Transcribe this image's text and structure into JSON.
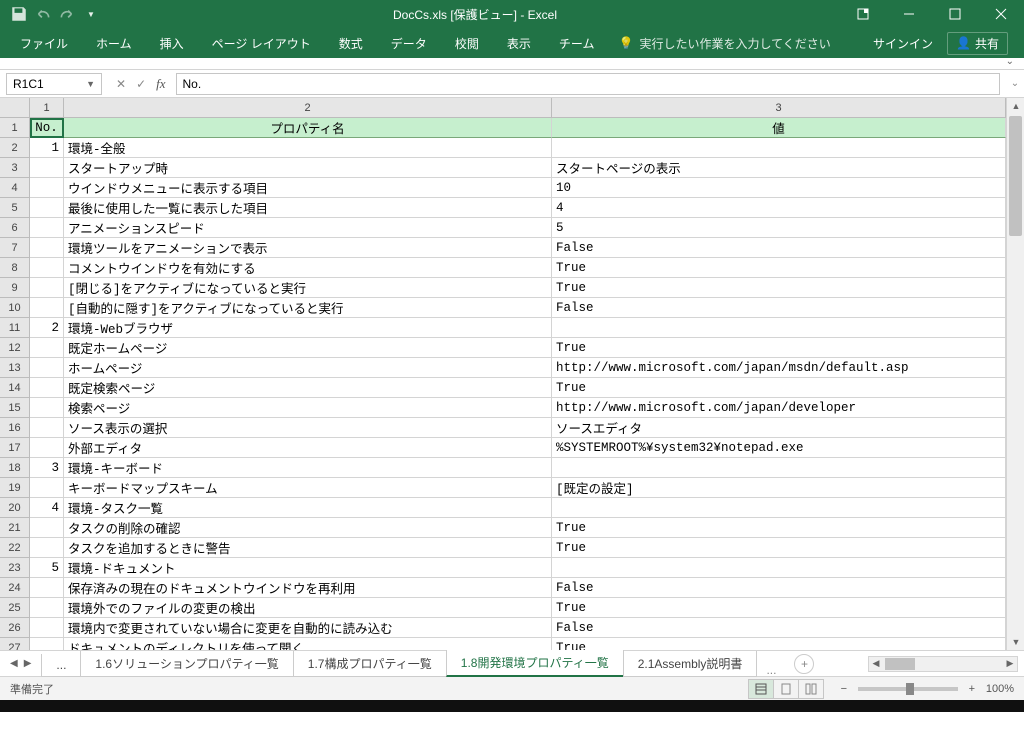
{
  "title": "DocCs.xls [保護ビュー] - Excel",
  "ribbon": {
    "file": "ファイル",
    "home": "ホーム",
    "insert": "挿入",
    "pageLayout": "ページ レイアウト",
    "formulas": "数式",
    "data": "データ",
    "review": "校閲",
    "view": "表示",
    "team": "チーム",
    "tellme": "実行したい作業を入力してください",
    "signin": "サインイン",
    "share": "共有"
  },
  "namebox": "R1C1",
  "formula": "No.",
  "columns": {
    "c1": "1",
    "c2": "2",
    "c3": "3"
  },
  "headers": {
    "no": "No.",
    "prop": "プロパティ名",
    "val": "値"
  },
  "rows": [
    {
      "n": "1",
      "no": "1",
      "prop": "環境-全般",
      "val": ""
    },
    {
      "n": "2",
      "no": "",
      "prop": "スタートアップ時",
      "val": "スタートページの表示"
    },
    {
      "n": "3",
      "no": "",
      "prop": "ウインドウメニューに表示する項目",
      "val": "10"
    },
    {
      "n": "4",
      "no": "",
      "prop": "最後に使用した一覧に表示した項目",
      "val": "4"
    },
    {
      "n": "5",
      "no": "",
      "prop": "アニメーションスピード",
      "val": "5"
    },
    {
      "n": "6",
      "no": "",
      "prop": "環境ツールをアニメーションで表示",
      "val": "False"
    },
    {
      "n": "7",
      "no": "",
      "prop": "コメントウインドウを有効にする",
      "val": "True"
    },
    {
      "n": "8",
      "no": "",
      "prop": "[閉じる]をアクティブになっていると実行",
      "val": "True"
    },
    {
      "n": "9",
      "no": "",
      "prop": "[自動的に隠す]をアクティブになっていると実行",
      "val": "False"
    },
    {
      "n": "10",
      "no": "2",
      "prop": "環境-Webブラウザ",
      "val": ""
    },
    {
      "n": "11",
      "no": "",
      "prop": "既定ホームページ",
      "val": "True"
    },
    {
      "n": "12",
      "no": "",
      "prop": "ホームページ",
      "val": "http://www.microsoft.com/japan/msdn/default.asp"
    },
    {
      "n": "13",
      "no": "",
      "prop": "既定検索ページ",
      "val": "True"
    },
    {
      "n": "14",
      "no": "",
      "prop": "検索ページ",
      "val": "http://www.microsoft.com/japan/developer"
    },
    {
      "n": "15",
      "no": "",
      "prop": "ソース表示の選択",
      "val": "ソースエディタ"
    },
    {
      "n": "16",
      "no": "",
      "prop": "外部エディタ",
      "val": "%SYSTEMROOT%¥system32¥notepad.exe"
    },
    {
      "n": "17",
      "no": "3",
      "prop": "環境-キーボード",
      "val": ""
    },
    {
      "n": "18",
      "no": "",
      "prop": "キーボードマップスキーム",
      "val": "[既定の設定]"
    },
    {
      "n": "19",
      "no": "4",
      "prop": "環境-タスク一覧",
      "val": ""
    },
    {
      "n": "20",
      "no": "",
      "prop": "タスクの削除の確認",
      "val": "True"
    },
    {
      "n": "21",
      "no": "",
      "prop": "タスクを追加するときに警告",
      "val": "True"
    },
    {
      "n": "22",
      "no": "5",
      "prop": "環境-ドキュメント",
      "val": ""
    },
    {
      "n": "23",
      "no": "",
      "prop": "保存済みの現在のドキュメントウインドウを再利用",
      "val": "False"
    },
    {
      "n": "24",
      "no": "",
      "prop": "環境外でのファイルの変更の検出",
      "val": "True"
    },
    {
      "n": "25",
      "no": "",
      "prop": "環境内で変更されていない場合に変更を自動的に読み込む",
      "val": "False"
    },
    {
      "n": "26",
      "no": "",
      "prop": "ドキュメントのディレクトリを使って開く",
      "val": "True"
    }
  ],
  "sheets": {
    "ellipsis": "...",
    "t1": "1.6ソリューションプロパティ一覧",
    "t2": "1.7構成プロパティ一覧",
    "t3": "1.8開発環境プロパティ一覧",
    "t4": "2.1Assembly説明書"
  },
  "status": {
    "ready": "準備完了",
    "zoom": "100%"
  }
}
